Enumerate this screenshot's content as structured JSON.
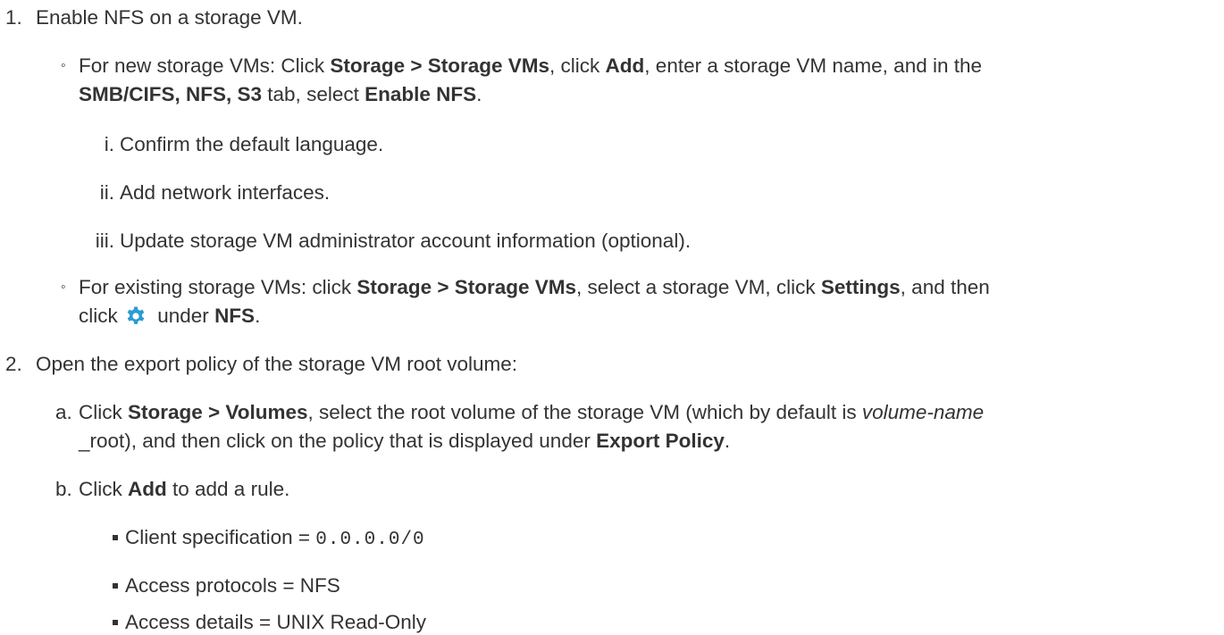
{
  "step1": {
    "marker": "1.",
    "text": "Enable NFS on a storage VM.",
    "new_vms": {
      "marker": "◦",
      "t1": "For new storage VMs: Click ",
      "b1": "Storage > Storage VMs",
      "t2": ", click ",
      "b2": "Add",
      "t3": ", enter a storage VM name, and in the",
      "b3": "SMB/CIFS, NFS, S3",
      "t4": " tab, select ",
      "b4": "Enable NFS",
      "t5": ".",
      "substeps": [
        {
          "marker": "i.",
          "text": "Confirm the default language."
        },
        {
          "marker": "ii.",
          "text": "Add network interfaces."
        },
        {
          "marker": "iii.",
          "text": "Update storage VM administrator account information (optional)."
        }
      ]
    },
    "existing_vms": {
      "marker": "◦",
      "t1": "For existing storage VMs: click ",
      "b1": "Storage > Storage VMs",
      "t2": ", select a storage VM, click ",
      "b2": "Settings",
      "t3": ", and then",
      "t4": "click ",
      "t5": " under ",
      "b3": "NFS",
      "t6": ".",
      "icon": "gear-icon",
      "icon_color": "#2b9bd3"
    }
  },
  "step2": {
    "marker": "2.",
    "text": "Open the export policy of the storage VM root volume:",
    "a": {
      "marker": "a.",
      "t1": "Click ",
      "b1": "Storage > Volumes",
      "t2": ", select the root volume of the storage VM (which by default is ",
      "i1": "volume-name",
      "t3": "_root), and then click on the policy that is displayed under ",
      "b2": "Export Policy",
      "t4": "."
    },
    "b": {
      "marker": "b.",
      "t1": "Click ",
      "b1": "Add",
      "t2": " to add a rule.",
      "rules": [
        {
          "label": "Client specification = ",
          "value": "0.0.0.0/0"
        },
        {
          "label": "Access protocols = NFS"
        },
        {
          "label": "Access details = UNIX Read-Only"
        }
      ]
    }
  }
}
